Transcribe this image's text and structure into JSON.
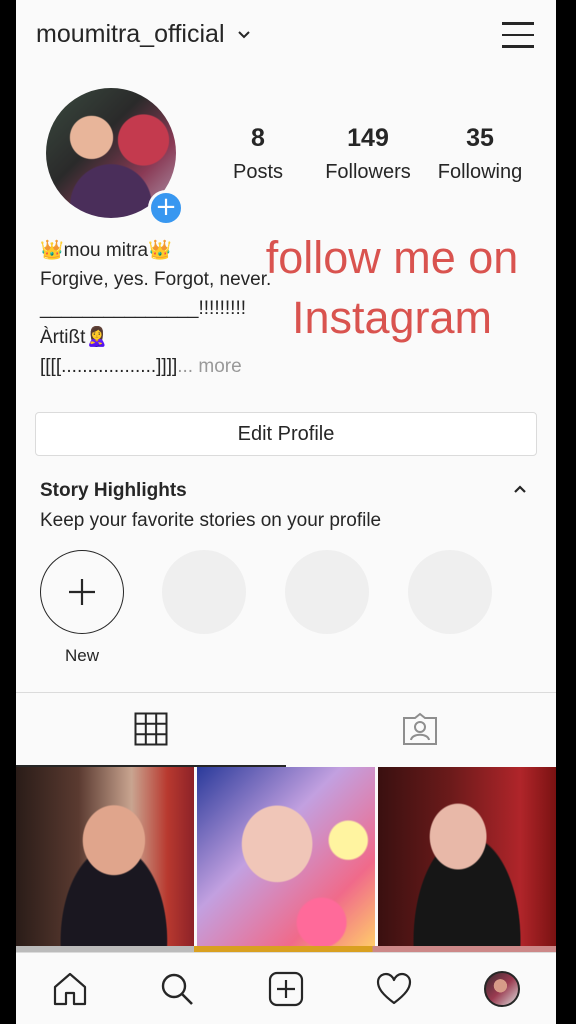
{
  "header": {
    "username": "moumitra_official"
  },
  "profile": {
    "stats": [
      {
        "value": "8",
        "label": "Posts"
      },
      {
        "value": "149",
        "label": "Followers"
      },
      {
        "value": "35",
        "label": "Following"
      }
    ],
    "bio_lines": [
      "👑mou mitra👑",
      "Forgive, yes. Forgot, never.",
      "_______________!!!!!!!!!",
      "Àrtißt🙎‍♀️",
      "[[[[..................]]]]"
    ],
    "bio_more": "... more",
    "overlay_text_line1": "follow me on",
    "overlay_text_line2": "Instagram",
    "edit_profile_label": "Edit Profile"
  },
  "highlights": {
    "title": "Story Highlights",
    "subtitle": "Keep your favorite stories on your profile",
    "new_label": "New"
  },
  "icons": {
    "menu": "hamburger-icon",
    "chevron": "chevron-down-icon",
    "grid": "grid-icon",
    "tagged": "tagged-icon",
    "home": "home-icon",
    "search": "search-icon",
    "add": "add-post-icon",
    "activity": "heart-icon"
  },
  "colors": {
    "accent": "#3897f0",
    "overlay_text": "#d9534f"
  }
}
